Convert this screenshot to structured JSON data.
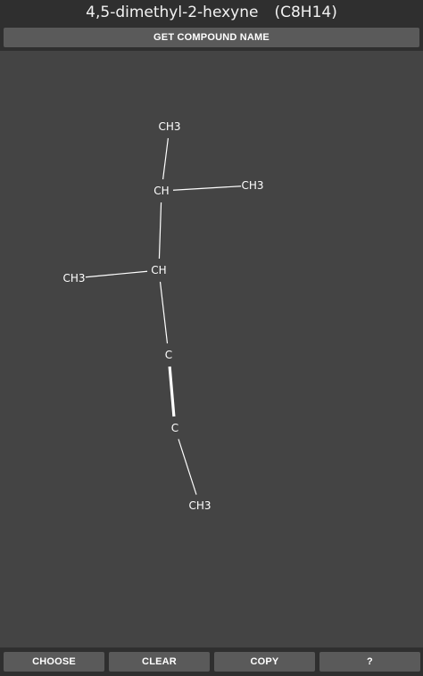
{
  "header": {
    "compound_name": "4,5-dimethyl-2-hexyne",
    "formula": "(C8H14)"
  },
  "toolbar": {
    "get_name_label": "GET COMPOUND NAME"
  },
  "structure": {
    "atoms": [
      {
        "id": "a1",
        "label": "CH3"
      },
      {
        "id": "a2",
        "label": "CH"
      },
      {
        "id": "a3",
        "label": "CH3"
      },
      {
        "id": "a4",
        "label": "CH"
      },
      {
        "id": "a5",
        "label": "CH3"
      },
      {
        "id": "a6",
        "label": "C"
      },
      {
        "id": "a7",
        "label": "C"
      },
      {
        "id": "a8",
        "label": "CH3"
      }
    ],
    "bonds": [
      {
        "from": "a1",
        "to": "a2",
        "order": 1
      },
      {
        "from": "a2",
        "to": "a3",
        "order": 1
      },
      {
        "from": "a2",
        "to": "a4",
        "order": 1
      },
      {
        "from": "a4",
        "to": "a5",
        "order": 1
      },
      {
        "from": "a4",
        "to": "a6",
        "order": 1
      },
      {
        "from": "a6",
        "to": "a7",
        "order": 3
      },
      {
        "from": "a7",
        "to": "a8",
        "order": 1
      }
    ]
  },
  "bottom_bar": {
    "choose_label": "CHOOSE",
    "clear_label": "CLEAR",
    "copy_label": "COPY",
    "help_label": "?"
  },
  "colors": {
    "background": "#2f2f2f",
    "canvas": "#444444",
    "button": "#5a5a5a",
    "text": "#ffffff"
  }
}
